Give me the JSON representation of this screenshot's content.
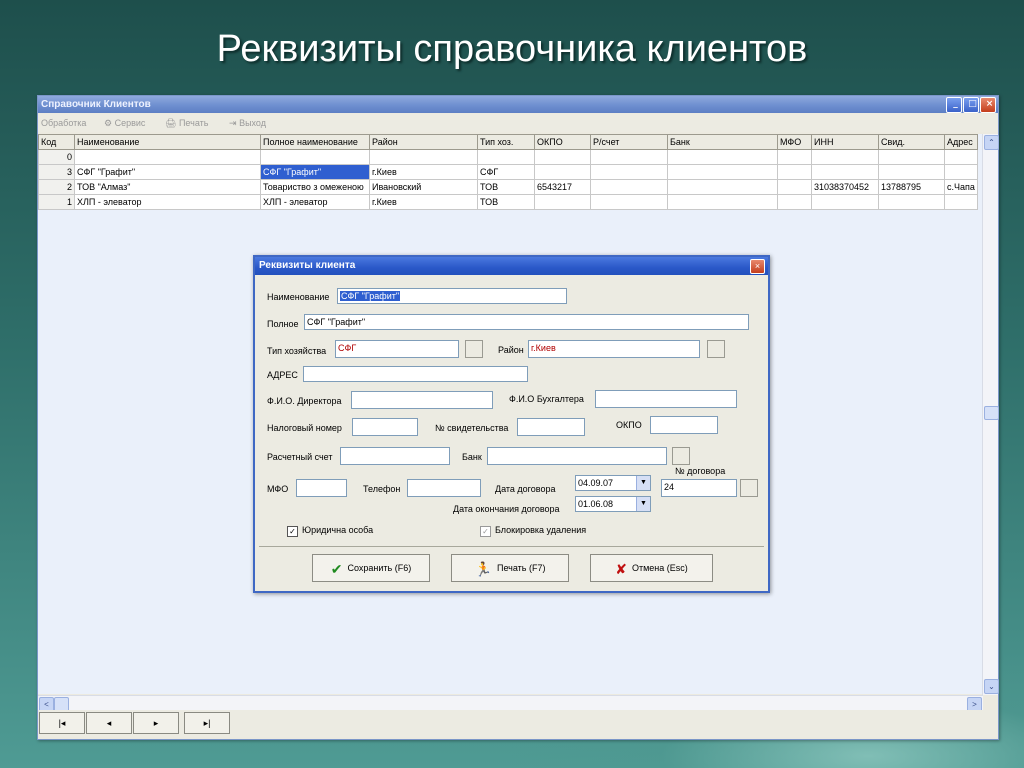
{
  "slide": {
    "title": "Реквизиты справочника клиентов"
  },
  "window": {
    "title": "Справочник Клиентов",
    "controls": {
      "minimize": "_",
      "maximize": "□",
      "close": "×"
    }
  },
  "menu": {
    "items": [
      {
        "label": "Обработка",
        "icon": ""
      },
      {
        "label": "Сервис",
        "icon": "⚙"
      },
      {
        "label": "Печать",
        "icon": "🖨"
      },
      {
        "label": "Выход",
        "icon": "⇥"
      }
    ]
  },
  "grid": {
    "columns": [
      "Код",
      "Наименование",
      "Полное наименование",
      "Район",
      "Тип хоз.",
      "ОКПО",
      "Р/счет",
      "Банк",
      "МФО",
      "ИНН",
      "Свид.",
      "Адрес"
    ],
    "rows": [
      [
        "0",
        "",
        "",
        "",
        "",
        "",
        "",
        "",
        "",
        "",
        "",
        ""
      ],
      [
        "3",
        "СФГ \"Графит\"",
        "СФГ \"Графит\"",
        "г.Киев",
        "СФГ",
        "",
        "",
        "",
        "",
        "",
        "",
        ""
      ],
      [
        "2",
        "ТОВ \"Алмаз\"",
        "Товариство з омеженою",
        "Ивановский",
        "ТОВ",
        "6543217",
        "",
        "",
        "",
        "31038370452",
        "13788795",
        "с.Чапа"
      ],
      [
        "1",
        "ХЛП - элеватор",
        "ХЛП - элеватор",
        "г.Киев",
        "ТОВ",
        "",
        "",
        "",
        "",
        "",
        "",
        ""
      ]
    ]
  },
  "scroll": {
    "up": "⌃",
    "down": "⌄",
    "left": "<",
    "right": ">"
  },
  "navigator": {
    "first": "|◂",
    "prev": "◂",
    "next": "▸",
    "last": "▸|"
  },
  "dialog": {
    "title": "Реквизиты клиента",
    "close": "×",
    "fields": {
      "name_label": "Наименование",
      "name_value": "СФГ \"Графит\"",
      "full_label": "Полное",
      "full_value": "СФГ \"Графит\"",
      "type_label": "Тип хозяйства",
      "type_value": "СФГ",
      "district_label": "Район",
      "district_value": "г.Киев",
      "address_label": "АДРЕС",
      "address_value": "",
      "director_label": "Ф.И.О. Директора",
      "director_value": "",
      "accountant_label": "Ф.И.О Бухгалтера",
      "accountant_value": "",
      "tax_label": "Налоговый номер",
      "tax_value": "",
      "cert_label": "№ свидетельства",
      "cert_value": "",
      "okpo_label": "ОКПО",
      "okpo_value": "",
      "account_label": "Расчетный счет",
      "account_value": "",
      "bank_label": "Банк",
      "bank_value": "",
      "mfo_label": "МФО",
      "mfo_value": "",
      "phone_label": "Телефон",
      "phone_value": "",
      "contract_no_label": "№ договора",
      "contract_no_value": "24",
      "contract_date_label": "Дата договора",
      "contract_date_value": "04.09.07",
      "contract_end_label": "Дата окончания договора",
      "contract_end_value": "01.06.08",
      "legal_entity_label": "Юридична особа",
      "legal_entity_checked": "✓",
      "delete_lock_label": "Блокировка удаления",
      "delete_lock_checked": "✓"
    },
    "buttons": {
      "save": "Сохранить (F6)",
      "print": "Печать (F7)",
      "cancel": "Отмена (Esc)"
    },
    "colors": {
      "save_icon": "#1f8a1f",
      "print_icon": "#1a9a2a",
      "cancel_icon": "#c01010"
    }
  }
}
